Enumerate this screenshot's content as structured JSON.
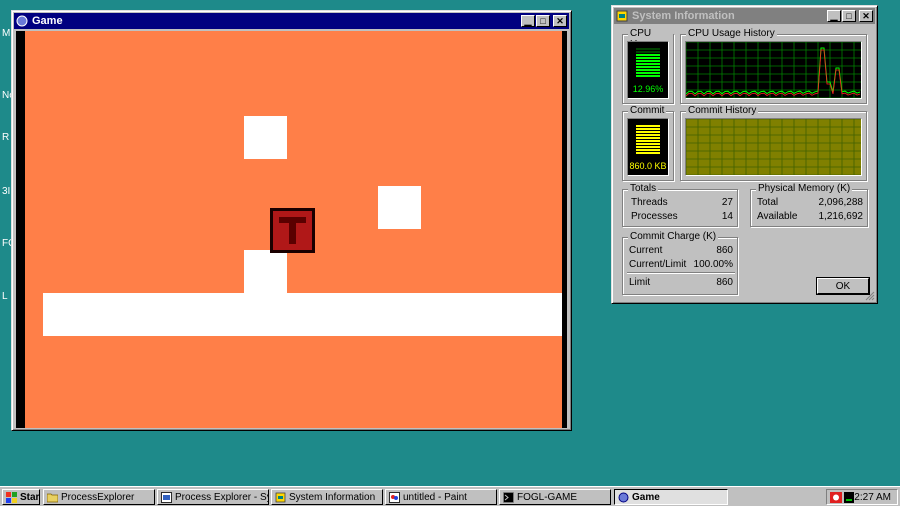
{
  "desktop": {
    "fragments": [
      "M",
      "Ne",
      "R",
      "3I",
      "FO",
      "L"
    ]
  },
  "game_window": {
    "title": "Game"
  },
  "system_info": {
    "title": "System Information",
    "cpu_usage_label": "CPU Usage",
    "cpu_usage_value": "12.96%",
    "cpu_history_label": "CPU Usage History",
    "commit_label": "Commit",
    "commit_value": "860.0 KB",
    "commit_history_label": "Commit History",
    "totals": {
      "label": "Totals",
      "threads_label": "Threads",
      "threads_value": "27",
      "processes_label": "Processes",
      "processes_value": "14"
    },
    "physical_memory": {
      "label": "Physical Memory (K)",
      "total_label": "Total",
      "total_value": "2,096,288",
      "available_label": "Available",
      "available_value": "1,216,692"
    },
    "commit_charge": {
      "label": "Commit Charge (K)",
      "current_label": "Current",
      "current_value": "860",
      "current_limit_label": "Current/Limit",
      "current_limit_value": "100.00%",
      "limit_label": "Limit",
      "limit_value": "860"
    },
    "ok_label": "OK",
    "colors": {
      "cpu": "#00ff00",
      "commit": "#ffff00"
    }
  },
  "taskbar": {
    "start_label": "Start",
    "items": [
      "ProcessExplorer",
      "Process Explorer - Sysinter...",
      "System Information",
      "untitled - Paint",
      "FOGL-GAME",
      "Game"
    ],
    "clock": "2:27 AM"
  }
}
